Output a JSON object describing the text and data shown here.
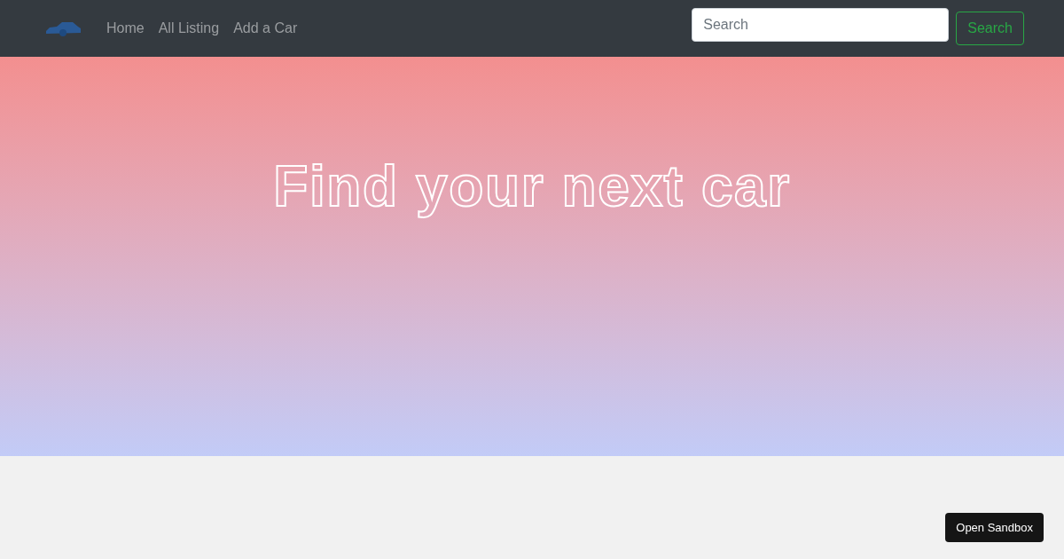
{
  "navbar": {
    "links": [
      {
        "label": "Home"
      },
      {
        "label": "All Listing"
      },
      {
        "label": "Add a Car"
      }
    ],
    "search": {
      "placeholder": "Search",
      "button": "Search"
    }
  },
  "hero": {
    "title": "Find your next car"
  },
  "sandbox_button": "Open Sandbox"
}
